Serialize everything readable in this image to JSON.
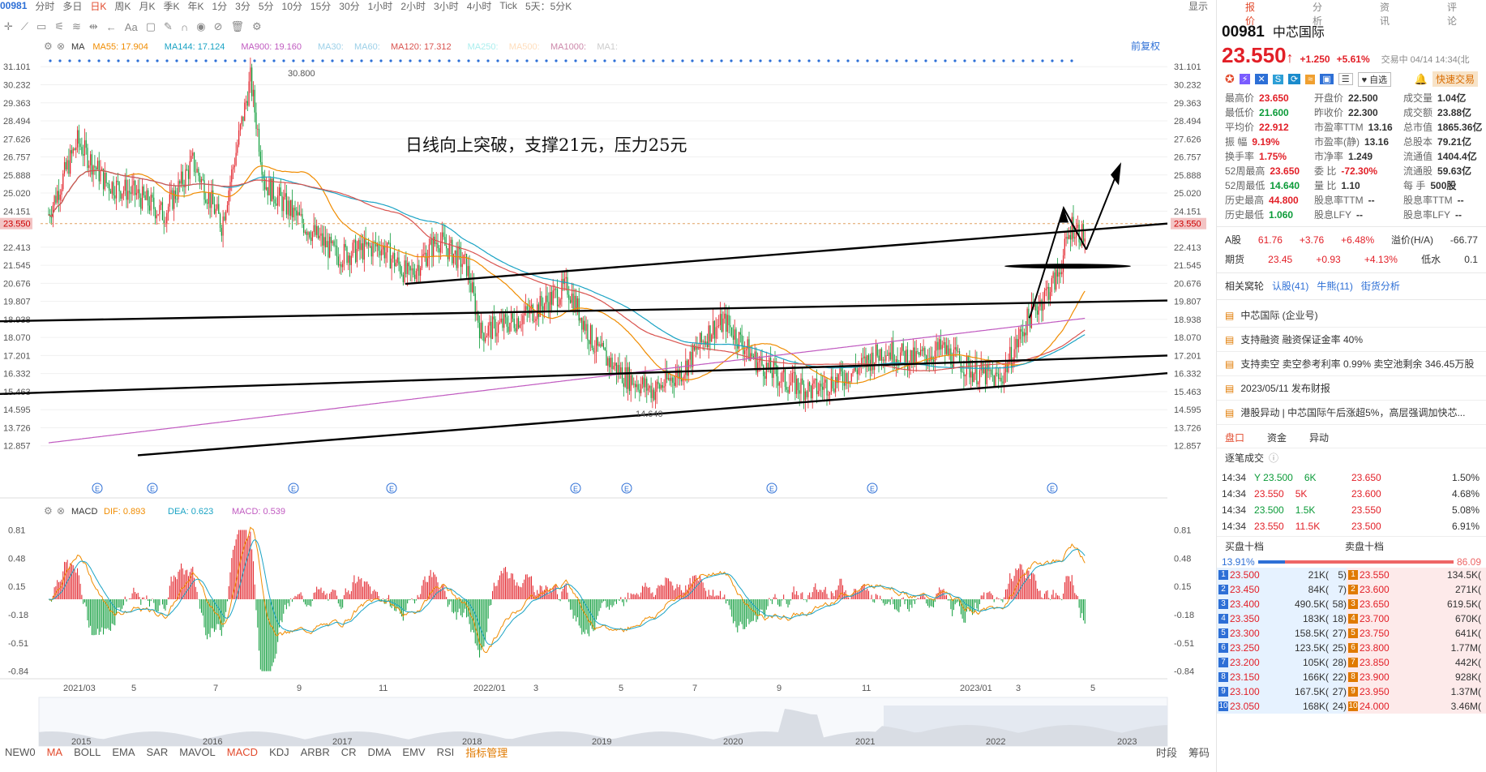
{
  "topbar": {
    "code": "00981",
    "tabs": [
      "分时",
      "多日",
      "日K",
      "周K",
      "月K",
      "季K",
      "年K",
      "1分",
      "3分",
      "5分",
      "10分",
      "15分",
      "30分",
      "1小时",
      "2小时",
      "3小时",
      "4小时",
      "Tick",
      "5天：5分K"
    ],
    "active": "日K",
    "display": "显示"
  },
  "chart": {
    "legend": [
      "MA",
      "MA55: 17.904",
      "MA144: 17.124",
      "MA900: 19.160",
      "MA30:",
      "MA60:",
      "MA120: 17.312",
      "MA250:",
      "MA500:",
      "MA1000:",
      "MA1:"
    ],
    "restore": "前复权",
    "annotation": "日线向上突破，支撑21元，压力25元",
    "high_label": "30.800",
    "low_label": "14.640",
    "last": "23.550",
    "y_ticks": [
      "31.101",
      "30.232",
      "29.363",
      "28.494",
      "27.626",
      "26.757",
      "25.888",
      "25.020",
      "24.151",
      "22.413",
      "21.545",
      "20.676",
      "19.807",
      "18.938",
      "18.070",
      "17.201",
      "16.332",
      "15.463",
      "14.595",
      "13.726",
      "12.857"
    ],
    "macd_legend": [
      "MACD",
      "DIF: 0.893",
      "DEA: 0.623",
      "MACD: 0.539"
    ],
    "macd_ticks": [
      "0.81",
      "0.48",
      "0.15",
      "-0.18",
      "-0.51",
      "-0.84"
    ],
    "x_ticks": [
      "2021/03",
      "5",
      "7",
      "9",
      "11",
      "2022/01",
      "3",
      "5",
      "7",
      "9",
      "11",
      "2023/01",
      "3",
      "5"
    ],
    "year_ticks": [
      "2015",
      "2016",
      "2017",
      "2018",
      "2019",
      "2020",
      "2021",
      "2022",
      "2023"
    ]
  },
  "indicators": [
    "NEW0",
    "MA",
    "BOLL",
    "EMA",
    "SAR",
    "MAVOL",
    "MACD",
    "KDJ",
    "ARBR",
    "CR",
    "DMA",
    "EMV",
    "RSI"
  ],
  "ind_active": [
    "MA",
    "MACD"
  ],
  "indicator_manage": "指标管理",
  "bottom_right": [
    "时段",
    "筹码"
  ],
  "right": {
    "tabs": [
      "报价",
      "分析",
      "资讯",
      "评论"
    ],
    "code": "00981",
    "name": "中芯国际",
    "price": "23.550",
    "change": "+1.250",
    "pct": "+5.61%",
    "status": "交易中 04/14 14:34(北",
    "watch": "自选",
    "fast": "快速交易",
    "stats": [
      [
        "最高价",
        "23.650",
        "开盘价",
        "22.500",
        "成交量",
        "1.04亿"
      ],
      [
        "最低价",
        "21.600",
        "昨收价",
        "22.300",
        "成交额",
        "23.88亿"
      ],
      [
        "平均价",
        "22.912",
        "市盈率TTM",
        "13.16",
        "总市值",
        "1865.36亿"
      ],
      [
        "振  幅",
        "9.19%",
        "市盈率(静)",
        "13.16",
        "总股本",
        "79.21亿"
      ],
      [
        "换手率",
        "1.75%",
        "市净率",
        "1.249",
        "流通值",
        "1404.4亿"
      ],
      [
        "52周最高",
        "23.650",
        "委  比",
        "-72.30%",
        "流通股",
        "59.63亿"
      ],
      [
        "52周最低",
        "14.640",
        "量  比",
        "1.10",
        "每  手",
        "500股"
      ],
      [
        "历史最高",
        "44.800",
        "股息率TTM",
        "--",
        "股息率TTM",
        "--"
      ],
      [
        "历史最低",
        "1.060",
        "股息LFY",
        "--",
        "股息率LFY",
        "--"
      ]
    ],
    "ashare": [
      "A股",
      "61.76",
      "+3.76",
      "+6.48%",
      "溢价(H/A)",
      "-66.77"
    ],
    "future": [
      "期货",
      "23.45",
      "+0.93",
      "+4.13%",
      "低水",
      "0.1"
    ],
    "related": [
      "相关窝轮",
      "认股(41)",
      "牛熊(11)",
      "街货分析"
    ],
    "news": [
      "中芯国际 (企业号)",
      "支持融资 融资保证金率 40%",
      "支持卖空 卖空参考利率 0.99% 卖空池剩余 346.45万股",
      "2023/05/11 发布财报",
      "港股异动 | 中芯国际午后涨超5%，高层强调加快芯..."
    ],
    "subtabs": [
      "盘口",
      "资金",
      "异动"
    ],
    "tick_title": "逐笔成交",
    "ticks": [
      [
        "14:34",
        "Y 23.500",
        "6K"
      ],
      [
        "14:34",
        "23.550",
        "5K"
      ],
      [
        "14:34",
        "23.500",
        "1.5K"
      ],
      [
        "14:34",
        "23.550",
        "11.5K"
      ]
    ],
    "levels": [
      [
        "23.650",
        "1.50%"
      ],
      [
        "23.600",
        "4.68%"
      ],
      [
        "23.550",
        "5.08%"
      ],
      [
        "23.500",
        "6.91%"
      ]
    ],
    "bid_title": "买盘十档",
    "ask_title": "卖盘十档",
    "bid_pct": "13.91%",
    "ask_pct": "86.09",
    "book": [
      [
        "23.500",
        "21K(",
        "5)",
        "23.550",
        "134.5K("
      ],
      [
        "23.450",
        "84K(",
        "7)",
        "23.600",
        "271K("
      ],
      [
        "23.400",
        "490.5K(",
        "58)",
        "23.650",
        "619.5K("
      ],
      [
        "23.350",
        "183K(",
        "18)",
        "23.700",
        "670K("
      ],
      [
        "23.300",
        "158.5K(",
        "27)",
        "23.750",
        "641K("
      ],
      [
        "23.250",
        "123.5K(",
        "25)",
        "23.800",
        "1.77M("
      ],
      [
        "23.200",
        "105K(",
        "28)",
        "23.850",
        "442K("
      ],
      [
        "23.150",
        "166K(",
        "22)",
        "23.900",
        "928K("
      ],
      [
        "23.100",
        "167.5K(",
        "27)",
        "23.950",
        "1.37M("
      ],
      [
        "23.050",
        "168K(",
        "24)",
        "24.000",
        "3.46M("
      ]
    ]
  },
  "colors": {
    "up": "#e21f27",
    "down": "#0b9b38",
    "ma55": "#f08c00",
    "ma144": "#1aa3c4",
    "ma900": "#c05ac0",
    "ma120": "#d9534f"
  }
}
